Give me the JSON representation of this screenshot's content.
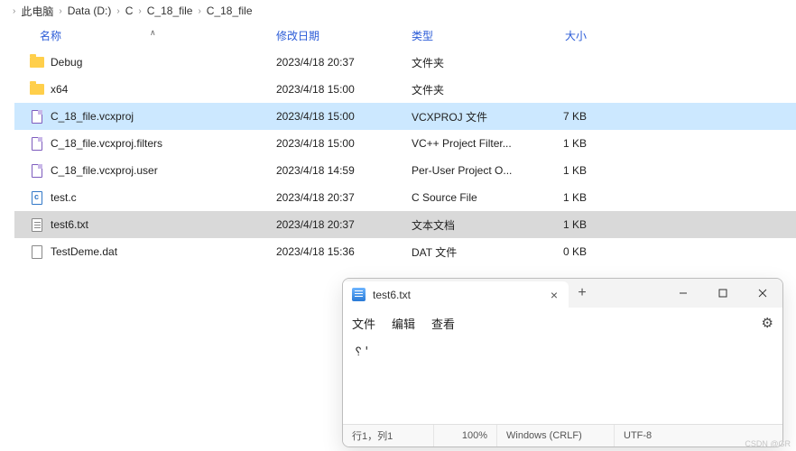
{
  "breadcrumb": [
    "此电脑",
    "Data (D:)",
    "C",
    "C_18_file",
    "C_18_file"
  ],
  "columns": {
    "name": "名称",
    "date": "修改日期",
    "type": "类型",
    "size": "大小"
  },
  "files": [
    {
      "icon": "folder",
      "name": "Debug",
      "date": "2023/4/18 20:37",
      "type": "文件夹",
      "size": ""
    },
    {
      "icon": "folder",
      "name": "x64",
      "date": "2023/4/18 15:00",
      "type": "文件夹",
      "size": ""
    },
    {
      "icon": "vcx",
      "name": "C_18_file.vcxproj",
      "date": "2023/4/18 15:00",
      "type": "VCXPROJ 文件",
      "size": "7 KB",
      "selected": true
    },
    {
      "icon": "vcx",
      "name": "C_18_file.vcxproj.filters",
      "date": "2023/4/18 15:00",
      "type": "VC++ Project Filter...",
      "size": "1 KB"
    },
    {
      "icon": "vcx",
      "name": "C_18_file.vcxproj.user",
      "date": "2023/4/18 14:59",
      "type": "Per-User Project O...",
      "size": "1 KB"
    },
    {
      "icon": "c",
      "name": "test.c",
      "date": "2023/4/18 20:37",
      "type": "C Source File",
      "size": "1 KB"
    },
    {
      "icon": "txt",
      "name": "test6.txt",
      "date": "2023/4/18 20:37",
      "type": "文本文档",
      "size": "1 KB",
      "highlighted": true
    },
    {
      "icon": "file",
      "name": "TestDeme.dat",
      "date": "2023/4/18 15:36",
      "type": "DAT 文件",
      "size": "0 KB"
    }
  ],
  "notepad": {
    "tab_title": "test6.txt",
    "menu": {
      "file": "文件",
      "edit": "编辑",
      "view": "查看"
    },
    "content": "␦'",
    "status": {
      "pos": "行1，列1",
      "zoom": "100%",
      "line_ending": "Windows (CRLF)",
      "encoding": "UTF-8"
    }
  },
  "watermark": "CSDN @GR"
}
